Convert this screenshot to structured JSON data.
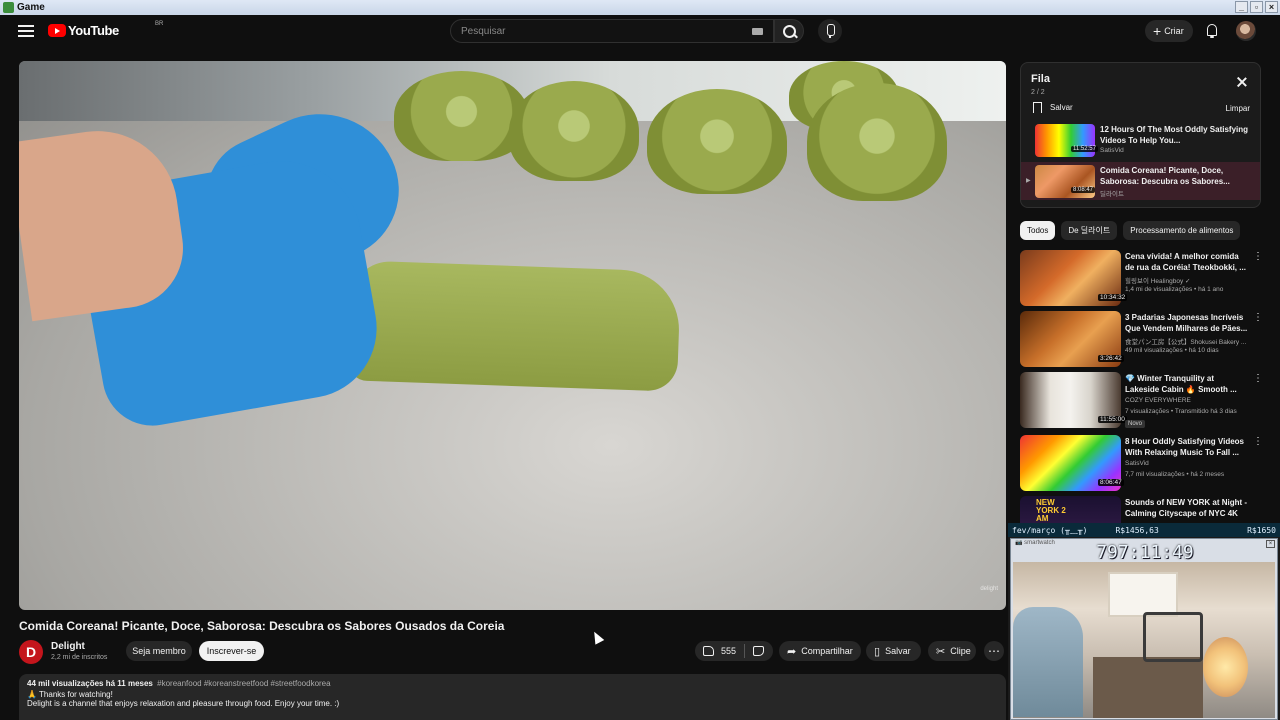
{
  "window": {
    "title": "Game"
  },
  "header": {
    "logo_text": "YouTube",
    "country_code": "BR",
    "search_placeholder": "Pesquisar",
    "create_label": "Criar"
  },
  "video": {
    "title": "Comida Coreana! Picante, Doce, Saborosa: Descubra os Sabores Ousados da Coreia",
    "watermark": "delight",
    "channel": {
      "name": "Delight",
      "subscribers": "2,2 mi de inscritos",
      "avatar_letter": "D"
    },
    "join_label": "Seja membro",
    "subscribe_label": "Inscrever-se",
    "likes": "555",
    "share_label": "Compartilhar",
    "save_label": "Salvar",
    "clip_label": "Clipe",
    "description": {
      "views": "44 mil visualizações",
      "age": "há 11 meses",
      "tags": "#koreanfood #koreanstreetfood #streetfoodkorea",
      "line1": "🙏 Thanks for watching!",
      "line2": "Delight is a channel that enjoys relaxation and pleasure through food. Enjoy your time. :)"
    }
  },
  "queue": {
    "title": "Fila",
    "count": "2 / 2",
    "save_label": "Salvar",
    "clear_label": "Limpar",
    "items": [
      {
        "title": "12 Hours Of The Most Oddly Satisfying Videos To Help You...",
        "channel": "SatisVid",
        "duration": "11:52:57"
      },
      {
        "title": "Comida Coreana! Picante, Doce, Saborosa: Descubra os Sabores...",
        "channel": "딜라이트",
        "duration": "8:08:47"
      }
    ]
  },
  "chips": [
    "Todos",
    "De 딜라이트",
    "Processamento de alimentos"
  ],
  "recommendations": [
    {
      "title": "Cena vívida! A melhor comida de rua da Coréia! Tteokbokki, ...",
      "channel": "힐링보이 Healingboy ✓",
      "meta": "1,4 mi de visualizações • há 1 ano",
      "duration": "10:34:32",
      "badge": ""
    },
    {
      "title": "3 Padarias Japonesas Incríveis Que Vendem Milhares de Pães...",
      "channel": "食堂パン工房【公式】Shokusei Bakery ...",
      "meta": "49 mil visualizações • há 10 dias",
      "duration": "3:26:42",
      "badge": ""
    },
    {
      "title": "💎 Winter Tranquility at Lakeside Cabin 🔥 Smooth ...",
      "channel": "COZY EVERYWHERE",
      "meta": "7 visualizações • Transmitido há 3 dias",
      "duration": "11:55:00",
      "badge": "Novo"
    },
    {
      "title": "8 Hour Oddly Satisfying Videos With Relaxing Music To Fall ...",
      "channel": "SatisVid",
      "meta": "7,7 mil visualizações • há 2 meses",
      "duration": "8:06:47",
      "badge": ""
    },
    {
      "title": "Sounds of NEW YORK at Night - Calming Cityscape of NYC 4K",
      "channel": "",
      "meta": "",
      "duration": "",
      "badge": "",
      "thumb_text": "NEW YORK 2 AM"
    }
  ],
  "overlay": {
    "label": "fev/março (╥﹏╥)",
    "amount1": "R$1456,63",
    "amount2": "R$1650",
    "window_title": "📷 smartwatch",
    "timer": "797:11:49"
  }
}
